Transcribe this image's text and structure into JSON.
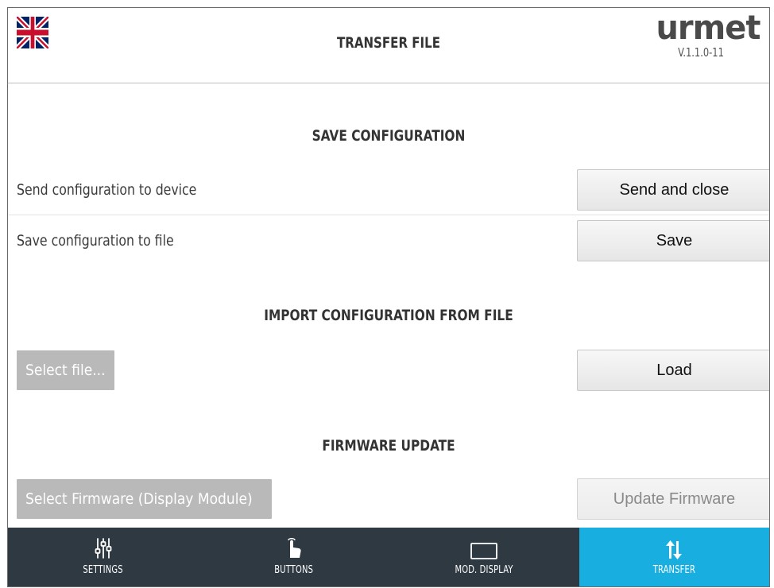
{
  "header": {
    "title": "TRANSFER FILE",
    "brand": "urmet",
    "version": "V.1.1.0-11",
    "language_icon": "uk-flag-icon"
  },
  "save_configuration": {
    "title": "SAVE CONFIGURATION",
    "rows": [
      {
        "label": "Send configuration to device",
        "button": "Send and close"
      },
      {
        "label": "Save configuration to file",
        "button": "Save"
      }
    ]
  },
  "import_configuration": {
    "title": "IMPORT CONFIGURATION FROM FILE",
    "select_button": "Select file...",
    "load_button": "Load"
  },
  "firmware_update": {
    "title": "FIRMWARE UPDATE",
    "select_button": "Select Firmware (Display Module)",
    "update_button": "Update Firmware",
    "update_enabled": false
  },
  "navbar": {
    "items": [
      {
        "label": "SETTINGS",
        "icon": "sliders-icon",
        "active": false
      },
      {
        "label": "BUTTONS",
        "icon": "hand-pointer-icon",
        "active": false
      },
      {
        "label": "MOD. DISPLAY",
        "icon": "display-icon",
        "active": false
      },
      {
        "label": "TRANSFER",
        "icon": "transfer-arrows-icon",
        "active": true
      }
    ]
  },
  "colors": {
    "navbar_bg": "#2f3942",
    "active_tab": "#19aee0",
    "grey_button": "#b9b9b9"
  }
}
